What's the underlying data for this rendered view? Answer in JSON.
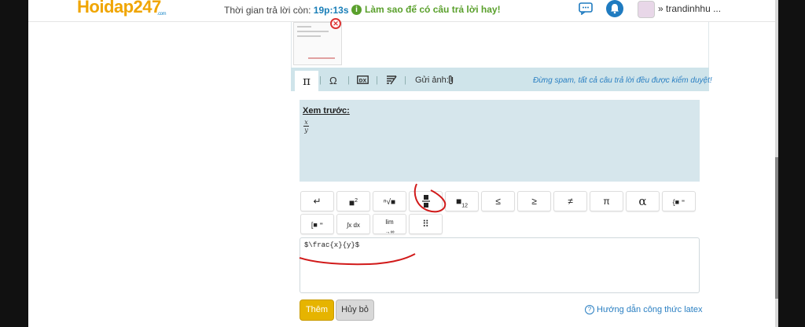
{
  "header": {
    "logo_main": "Hoidap247",
    "logo_sub": ".com",
    "timer_label": "Thời gian trả lời còn: ",
    "timer_value": "19p:13s",
    "tip": "Làm sao để có câu trả lời hay!",
    "username": "trandinhhu ..."
  },
  "toolbar": {
    "pi_label": "π",
    "omega_label": "Ω",
    "upload_label": "Gửi ảnh:",
    "warning": "Đừng spam, tất cả câu trả lời đều được kiểm duyệt!"
  },
  "preview": {
    "title": "Xem trước:",
    "numerator": "x",
    "denominator": "y"
  },
  "symbols": {
    "enter": "↵",
    "superscript_exp": "2",
    "subscript_exp": "12",
    "le": "≤",
    "ge": "≥",
    "neq": "≠",
    "pi": "π",
    "alpha": "α",
    "integral": "∫x dx",
    "limit": "lim",
    "limit_sub": "→∞",
    "matrix": "⠿"
  },
  "editor": {
    "value": "$\\frac{x}{y}$"
  },
  "actions": {
    "add": "Thêm",
    "cancel": "Hủy bỏ",
    "latex_help": "Hướng dẫn công thức latex"
  },
  "colors": {
    "accent": "#e6b400",
    "link": "#2a7fc2",
    "panel": "#cfe4ea",
    "annotation": "#d11a1a"
  }
}
